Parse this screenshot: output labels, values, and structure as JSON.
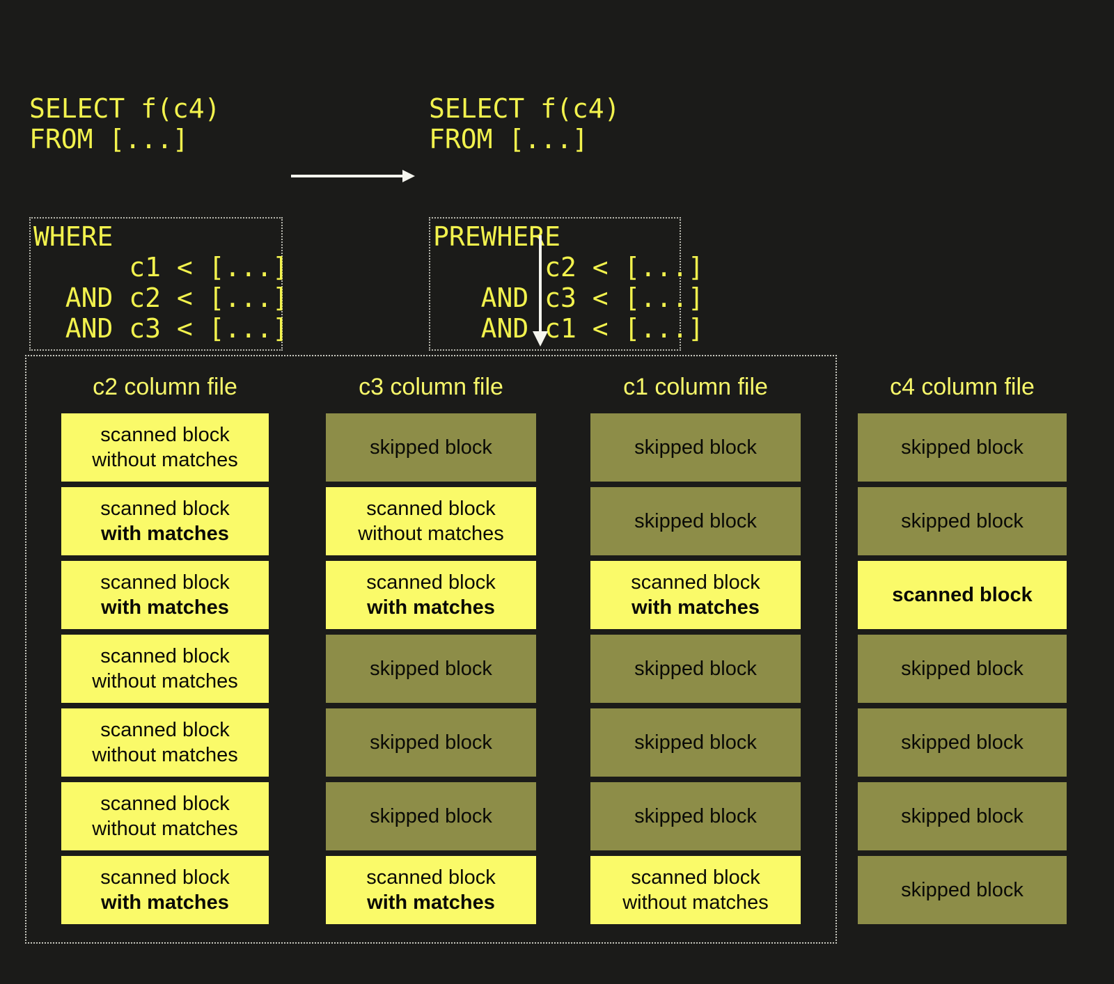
{
  "queries": {
    "left": {
      "header_lines": "SELECT f(c4)\nFROM [...]",
      "filter_text": "WHERE\n      c1 < [...]\n  AND c2 < [...]\n  AND c3 < [...]"
    },
    "right": {
      "header_lines": "SELECT f(c4)\nFROM [...]",
      "filter_text": "PREWHERE\n       c2 < [...]\n   AND c3 < [...]\n   AND c1 < [...]"
    }
  },
  "colors": {
    "background": "#1b1b19",
    "scanned": "#fafa69",
    "skipped": "#8d8d48",
    "title": "#f7f76a",
    "sql_text": "#f2f24d",
    "arrow": "#f5f5ee",
    "dashed_border": "#c9c9c0"
  },
  "columns": [
    {
      "id": "c2",
      "title": "c2 column file",
      "blocks": [
        {
          "kind": "scanned",
          "line1": "scanned block",
          "line2": "without matches",
          "bold2": false
        },
        {
          "kind": "scanned",
          "line1": "scanned block",
          "line2": "with matches",
          "bold2": true
        },
        {
          "kind": "scanned",
          "line1": "scanned block",
          "line2": "with matches",
          "bold2": true
        },
        {
          "kind": "scanned",
          "line1": "scanned block",
          "line2": "without matches",
          "bold2": false
        },
        {
          "kind": "scanned",
          "line1": "scanned block",
          "line2": "without matches",
          "bold2": false
        },
        {
          "kind": "scanned",
          "line1": "scanned block",
          "line2": "without matches",
          "bold2": false
        },
        {
          "kind": "scanned",
          "line1": "scanned block",
          "line2": "with matches",
          "bold2": true
        }
      ]
    },
    {
      "id": "c3",
      "title": "c3 column file",
      "blocks": [
        {
          "kind": "skipped",
          "line1": "skipped block",
          "line2": "",
          "bold2": false
        },
        {
          "kind": "scanned",
          "line1": "scanned block",
          "line2": "without matches",
          "bold2": false
        },
        {
          "kind": "scanned",
          "line1": "scanned block",
          "line2": "with matches",
          "bold2": true
        },
        {
          "kind": "skipped",
          "line1": "skipped block",
          "line2": "",
          "bold2": false
        },
        {
          "kind": "skipped",
          "line1": "skipped block",
          "line2": "",
          "bold2": false
        },
        {
          "kind": "skipped",
          "line1": "skipped block",
          "line2": "",
          "bold2": false
        },
        {
          "kind": "scanned",
          "line1": "scanned block",
          "line2": "with matches",
          "bold2": true
        }
      ]
    },
    {
      "id": "c1",
      "title": "c1 column file",
      "blocks": [
        {
          "kind": "skipped",
          "line1": "skipped block",
          "line2": "",
          "bold2": false
        },
        {
          "kind": "skipped",
          "line1": "skipped block",
          "line2": "",
          "bold2": false
        },
        {
          "kind": "scanned",
          "line1": "scanned block",
          "line2": "with matches",
          "bold2": true
        },
        {
          "kind": "skipped",
          "line1": "skipped block",
          "line2": "",
          "bold2": false
        },
        {
          "kind": "skipped",
          "line1": "skipped block",
          "line2": "",
          "bold2": false
        },
        {
          "kind": "skipped",
          "line1": "skipped block",
          "line2": "",
          "bold2": false
        },
        {
          "kind": "scanned",
          "line1": "scanned block",
          "line2": "without matches",
          "bold2": false
        }
      ]
    },
    {
      "id": "c4",
      "title": "c4 column file",
      "blocks": [
        {
          "kind": "skipped",
          "line1": "skipped block",
          "line2": "",
          "bold2": false
        },
        {
          "kind": "skipped",
          "line1": "skipped block",
          "line2": "",
          "bold2": false
        },
        {
          "kind": "scanned",
          "line1": "scanned block",
          "line2": "",
          "bold2": false,
          "bold1": true
        },
        {
          "kind": "skipped",
          "line1": "skipped block",
          "line2": "",
          "bold2": false
        },
        {
          "kind": "skipped",
          "line1": "skipped block",
          "line2": "",
          "bold2": false
        },
        {
          "kind": "skipped",
          "line1": "skipped block",
          "line2": "",
          "bold2": false
        },
        {
          "kind": "skipped",
          "line1": "skipped block",
          "line2": "",
          "bold2": false
        }
      ]
    }
  ],
  "arrows": [
    {
      "id": "where-to-prewhere",
      "direction": "right"
    },
    {
      "id": "prewhere-to-storage",
      "direction": "down"
    }
  ]
}
